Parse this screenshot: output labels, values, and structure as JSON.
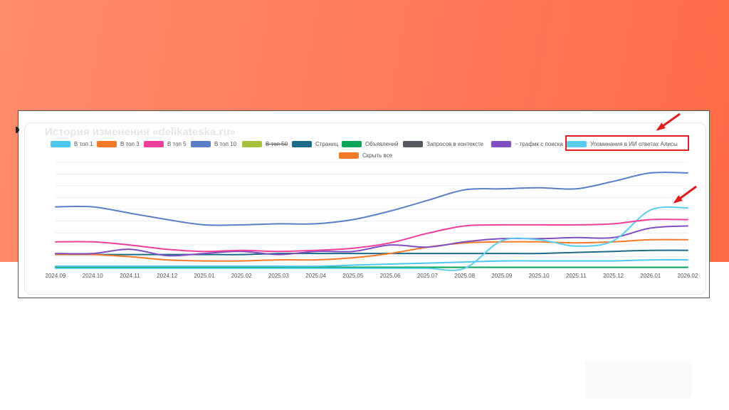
{
  "panel": {
    "title": "История изменения «delikateska.ru»"
  },
  "legend": [
    {
      "label": "В топ 1",
      "color": "#4fc8f0",
      "struck": false
    },
    {
      "label": "В топ 3",
      "color": "#f47a2a",
      "struck": false
    },
    {
      "label": "В топ 5",
      "color": "#ee3f9a",
      "struck": false
    },
    {
      "label": "В топ 10",
      "color": "#5a7fc6",
      "struck": false
    },
    {
      "label": "В топ 50",
      "color": "#a6c13c",
      "struck": true
    },
    {
      "label": "Страниц",
      "color": "#1e6b87",
      "struck": false
    },
    {
      "label": "Объявлений",
      "color": "#0aa45a",
      "struck": false
    },
    {
      "label": "Запросов в контексте",
      "color": "#555a60",
      "struck": false
    },
    {
      "label": "~ трафик с поиска",
      "color": "#7f4fbf",
      "struck": false
    },
    {
      "label": "Упоминания в ИИ ответах Алисы",
      "color": "#5ccdf0",
      "struck": false
    },
    {
      "label": "Скрыть все",
      "color": "#f47a2a",
      "struck": false
    }
  ],
  "chart_data": {
    "type": "line",
    "x": [
      "2024.09",
      "2024.10",
      "2024.11",
      "2024.12",
      "2025.01",
      "2025.02",
      "2025.03",
      "2025.04",
      "2025.05",
      "2025.06",
      "2025.07",
      "2025.08",
      "2025.09",
      "2025.10",
      "2025.11",
      "2025.12",
      "2026.01",
      "2026.02"
    ],
    "ylim": [
      0,
      100
    ],
    "grid": true,
    "legend_position": "top",
    "series": [
      {
        "name": "В топ 10",
        "color": "#5a7fc6",
        "values": [
          58,
          58,
          52,
          46,
          41,
          41,
          42,
          42,
          46,
          54,
          64,
          74,
          75,
          76,
          75,
          82,
          90,
          90
        ]
      },
      {
        "name": "~ трафик с поиска",
        "color": "#ee3f9a",
        "values": [
          25,
          25,
          22,
          18,
          16,
          17,
          16,
          17,
          19,
          24,
          33,
          40,
          41,
          41,
          41,
          42,
          46,
          46
        ]
      },
      {
        "name": "Упоминания в ИИ ответах Алисы",
        "color": "#5ccdf0",
        "values": [
          0,
          0,
          0,
          0,
          0,
          0,
          0,
          0,
          0,
          0,
          0,
          0,
          26,
          27,
          21,
          26,
          55,
          57
        ]
      },
      {
        "name": "Запросов в контексте",
        "color": "#7f4fbf",
        "values": [
          14,
          14,
          18,
          12,
          14,
          16,
          13,
          16,
          16,
          22,
          20,
          25,
          28,
          28,
          29,
          29,
          38,
          40
        ]
      },
      {
        "name": "В топ 3",
        "color": "#f47a2a",
        "values": [
          13,
          13,
          11,
          8,
          7,
          7,
          8,
          8,
          10,
          14,
          20,
          24,
          25,
          25,
          24,
          25,
          27,
          27
        ]
      },
      {
        "name": "Страниц",
        "color": "#1e6b87",
        "values": [
          13,
          13,
          13,
          13,
          13,
          13,
          14,
          14,
          14,
          14,
          14,
          14,
          14,
          14,
          15,
          16,
          17,
          17
        ]
      },
      {
        "name": "В топ 1",
        "color": "#4fc8f0",
        "values": [
          2,
          2,
          2,
          2,
          2,
          2,
          2,
          2,
          3,
          4,
          5,
          6,
          7,
          7,
          7,
          7,
          8,
          8
        ]
      },
      {
        "name": "Объявлений",
        "color": "#0aa45a",
        "values": [
          1,
          1,
          1,
          1,
          1,
          1,
          1,
          1,
          1,
          1,
          1,
          1,
          1,
          1,
          1,
          1,
          1,
          1
        ]
      }
    ]
  }
}
